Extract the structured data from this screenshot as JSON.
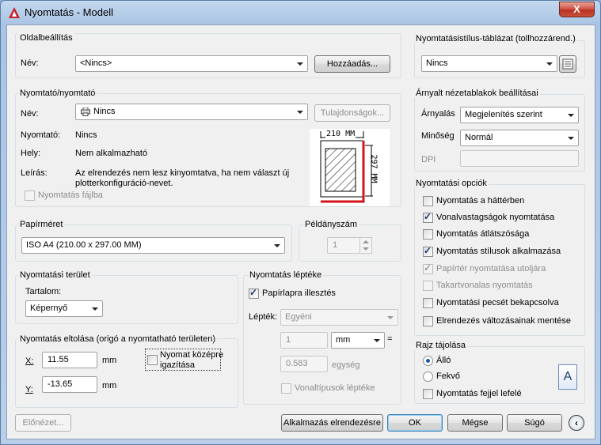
{
  "window": {
    "title": "Nyomtatás - Modell",
    "close": "X"
  },
  "page_setup": {
    "group_title": "Oldalbeállítás",
    "name_label": "Név:",
    "name_value": "<Nincs>",
    "add_button": "Hozzáadás..."
  },
  "printer": {
    "group_title": "Nyomtató/nyomtató",
    "name_label": "Név:",
    "name_value": "Nincs",
    "properties_button": "Tulajdonságok...",
    "plotter_label": "Nyomtató:",
    "plotter_value": "Nincs",
    "where_label": "Hely:",
    "where_value": "Nem alkalmazható",
    "desc_label": "Leírás:",
    "desc_line1": "Az elrendezés nem lesz kinyomtatva, ha nem választ új",
    "desc_line2": "plotterkonfiguráció-nevet.",
    "print_to_file": "Nyomtatás fájlba",
    "preview_width": "210 MM",
    "preview_height": "297 MM"
  },
  "paper_size": {
    "group_title": "Papírméret",
    "value": "ISO A4 (210.00 x 297.00 MM)"
  },
  "copies": {
    "group_title": "Példányszám",
    "value": "1"
  },
  "plot_area": {
    "group_title": "Nyomtatási terület",
    "what_label": "Tartalom:",
    "what_value": "Képernyő"
  },
  "plot_offset": {
    "group_title": "Nyomtatás eltolása (origó a nyomtatható területen)",
    "x_label": "X:",
    "x_value": "11.55",
    "x_unit": "mm",
    "y_label": "Y:",
    "y_value": "-13.65",
    "y_unit": "mm",
    "center_line1": "Nyomat középre",
    "center_line2": "igazítása"
  },
  "plot_scale": {
    "group_title": "Nyomtatás léptéke",
    "fit_to_paper": "Papírlapra illesztés",
    "scale_label": "Lépték:",
    "scale_value": "Egyéni",
    "value1": "1",
    "unit_value": "mm",
    "equals": "=",
    "value2": "0.583",
    "unit_label": "egység",
    "scale_lineweights": "Vonaltípusok léptéke"
  },
  "plot_style_table": {
    "group_title": "Nyomtatásistílus-táblázat (tollhozzárend.)",
    "value": "Nincs"
  },
  "shaded_viewport": {
    "group_title": "Árnyalt nézetablakok beállításai",
    "shade_label": "Árnyalás",
    "shade_value": "Megjelenítés szerint",
    "quality_label": "Minőség",
    "quality_value": "Normál",
    "dpi_label": "DPI"
  },
  "plot_options": {
    "group_title": "Nyomtatási opciók",
    "items": [
      {
        "label": "Nyomtatás a háttérben",
        "checked": false,
        "disabled": false
      },
      {
        "label": "Vonalvastagságok nyomtatása",
        "checked": true,
        "disabled": false
      },
      {
        "label": "Nyomtatás átlátszósága",
        "checked": false,
        "disabled": false
      },
      {
        "label": "Nyomtatás stílusok alkalmazása",
        "checked": true,
        "disabled": false
      },
      {
        "label": "Papírtér nyomtatása utoljára",
        "checked": true,
        "disabled": true
      },
      {
        "label": "Takartvonalas nyomtatás",
        "checked": false,
        "disabled": true
      },
      {
        "label": "Nyomtatási pecsét bekapcsolva",
        "checked": false,
        "disabled": false
      },
      {
        "label": "Elrendezés változásainak mentése",
        "checked": false,
        "disabled": false
      }
    ]
  },
  "orientation": {
    "group_title": "Rajz tájolása",
    "portrait": "Álló",
    "landscape": "Fekvő",
    "upside_down": "Nyomtatás fejjel lefelé",
    "icon_letter": "A"
  },
  "buttons": {
    "preview": "Előnézet...",
    "apply": "Alkalmazás elrendezésre",
    "ok": "OK",
    "cancel": "Mégse",
    "help": "Súgó"
  }
}
